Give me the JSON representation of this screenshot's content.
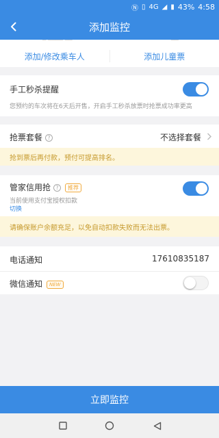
{
  "status_bar": {
    "battery": "43%",
    "time": "4:58",
    "network": "4G"
  },
  "header": {
    "title": "添加监控"
  },
  "passengers": {
    "add_edit_label": "添加/修改乘车人",
    "add_child_label": "添加儿童票"
  },
  "manual_reminder": {
    "title": "手工秒杀提醒",
    "description": "您预约的车次将在6天后开售，开启手工秒杀放票时抢票成功率更高",
    "enabled": true
  },
  "package": {
    "label": "抢票套餐",
    "value": "不选择套餐",
    "notice": "抢到票后再付款，预付可提高排名。"
  },
  "credit_grab": {
    "title": "管家信用抢",
    "tag": "推荐",
    "description": "当前使用支付宝授权扣款",
    "switch_link": "切换",
    "enabled": true,
    "notice": "请确保账户余额充足，以免自动扣款失败而无法出票。"
  },
  "phone_notify": {
    "label": "电话通知",
    "value": "17610835187"
  },
  "wechat_notify": {
    "label": "微信通知",
    "tag": "NEW",
    "enabled": false
  },
  "submit": {
    "label": "立即监控"
  },
  "colors": {
    "primary": "#3a8be3",
    "notice_bg": "#fdf6dc",
    "notice_text": "#c69a2e",
    "tag": "#f0a93b"
  }
}
